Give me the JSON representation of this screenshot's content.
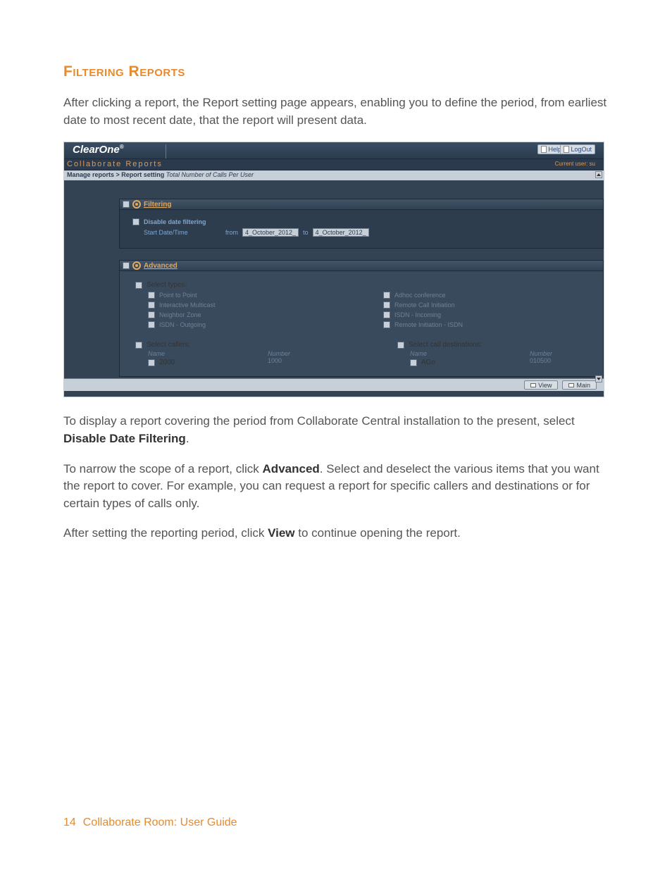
{
  "doc": {
    "section_title": "Filtering Reports",
    "intro": "After clicking a report, the Report setting page appears, enabling you to define the period, from earliest date to most recent date, that the report will present data.",
    "para2_a": "To display a report covering the period from Collaborate Central installation to the present, select ",
    "para2_b": "Disable Date Filtering",
    "para2_c": ".",
    "para3_a": "To narrow the scope of a report, click ",
    "para3_b": "Advanced",
    "para3_c": ". Select and deselect the various items that you want the report to cover. For example, you can request a report for specific callers and destinations or for certain types of calls only.",
    "para4_a": "After setting the reporting period, click ",
    "para4_b": "View",
    "para4_c": " to continue opening the report.",
    "page_num": "14",
    "page_label": "Collaborate Room: User Guide"
  },
  "ui": {
    "logo": "ClearOne",
    "help": "Help",
    "logout": "LogOut",
    "subtitle": "Collaborate Reports",
    "current_user": "Current user: su",
    "breadcrumb_a": "Manage reports > Report setting",
    "breadcrumb_b": "Total Number of Calls Per User",
    "filtering": "Filtering",
    "disable_date": "Disable date filtering",
    "start_dt": "Start Date/Time",
    "from": "from",
    "to": "to",
    "date_from": "4_October_2012_",
    "date_to": "4_October_2012_",
    "advanced": "Advanced",
    "select_types": "Select types:",
    "types_left": [
      "Point to Point",
      "Interactive Multicast",
      "Neighbor Zone",
      "ISDN - Outgoing"
    ],
    "types_right": [
      "Adhoc conference",
      "Remote Call Initiation",
      "ISDN - Incoming",
      "Remote Initiation - ISDN"
    ],
    "select_callers": "Select callers:",
    "select_dest": "Select call destinations:",
    "name": "Name",
    "number": "Number",
    "caller_name": "2000",
    "caller_number": "1000",
    "dest_name": "AGo",
    "dest_number": "010500",
    "view": "View",
    "main": "Main"
  }
}
